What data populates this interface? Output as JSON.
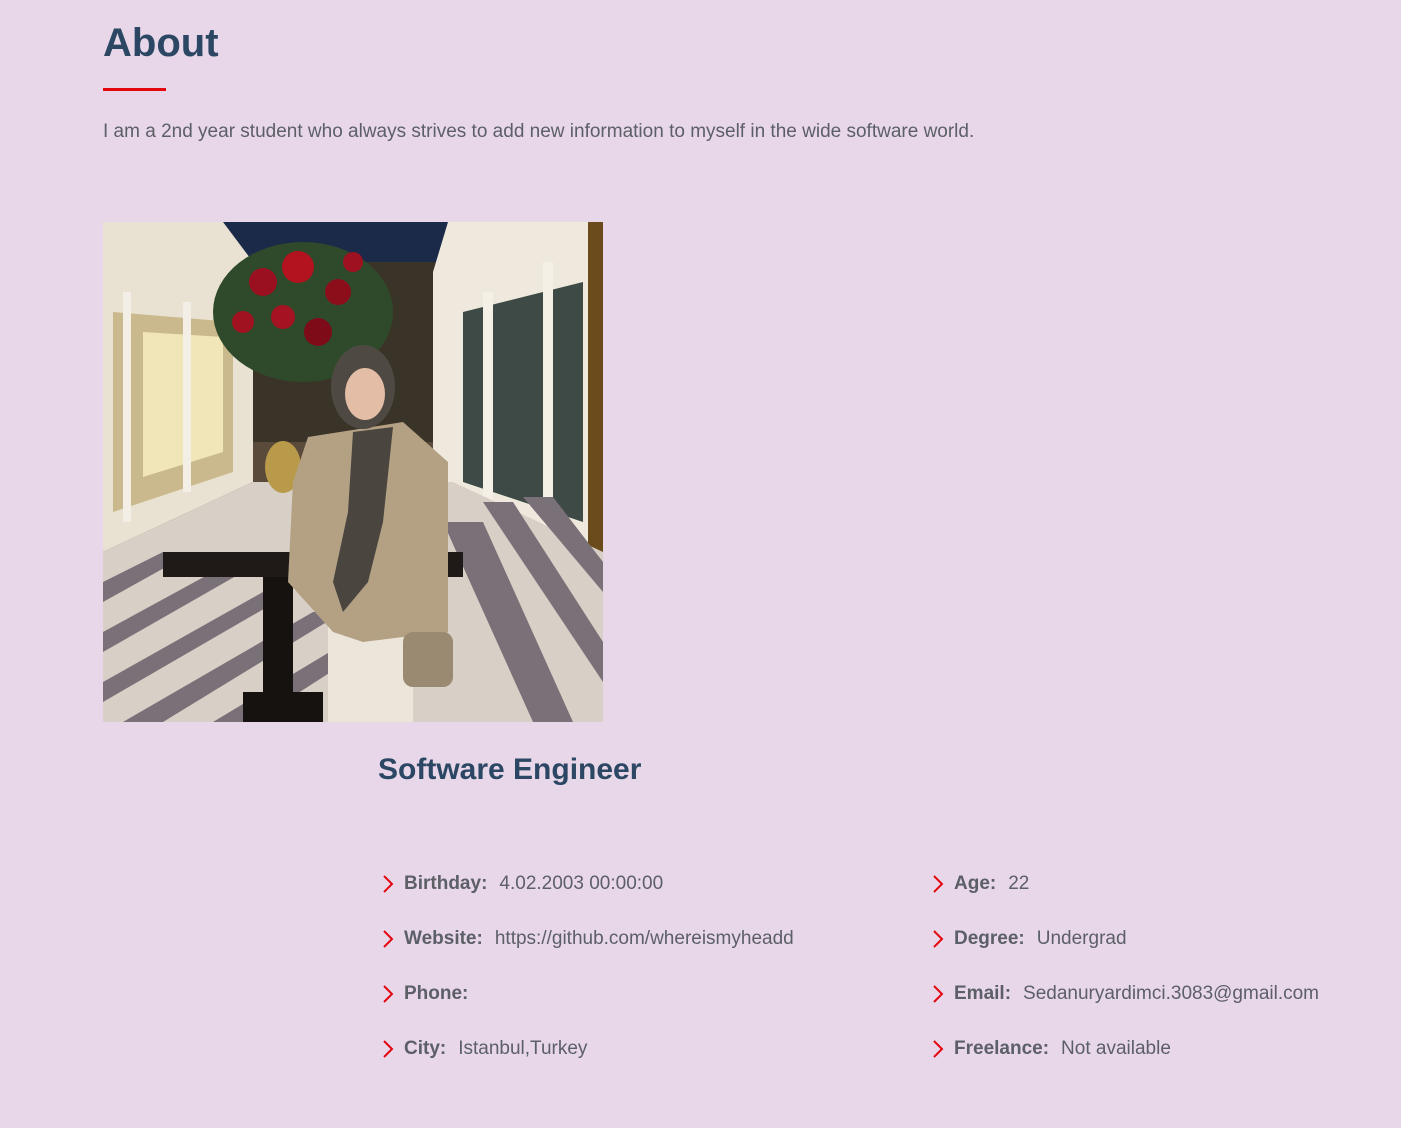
{
  "about": {
    "title": "About",
    "intro": "I am a 2nd year student who always strives to add new information to myself in the wide software world."
  },
  "profile": {
    "role": "Software Engineer",
    "left": [
      {
        "label": "Birthday:",
        "value": "4.02.2003 00:00:00"
      },
      {
        "label": "Website:",
        "value": "https://github.com/whereismyheadd"
      },
      {
        "label": "Phone:",
        "value": ""
      },
      {
        "label": "City:",
        "value": "Istanbul,Turkey"
      }
    ],
    "right": [
      {
        "label": "Age:",
        "value": "22"
      },
      {
        "label": "Degree:",
        "value": "Undergrad"
      },
      {
        "label": "Email:",
        "value": "Sedanuryardimci.3083@gmail.com"
      },
      {
        "label": "Freelance:",
        "value": "Not available"
      }
    ]
  },
  "colors": {
    "background": "#e8d7e9",
    "heading": "#2b4763",
    "accent": "#e3060f",
    "text": "#5c5f66"
  },
  "icons": {
    "bullet": "chevron-right-icon"
  }
}
